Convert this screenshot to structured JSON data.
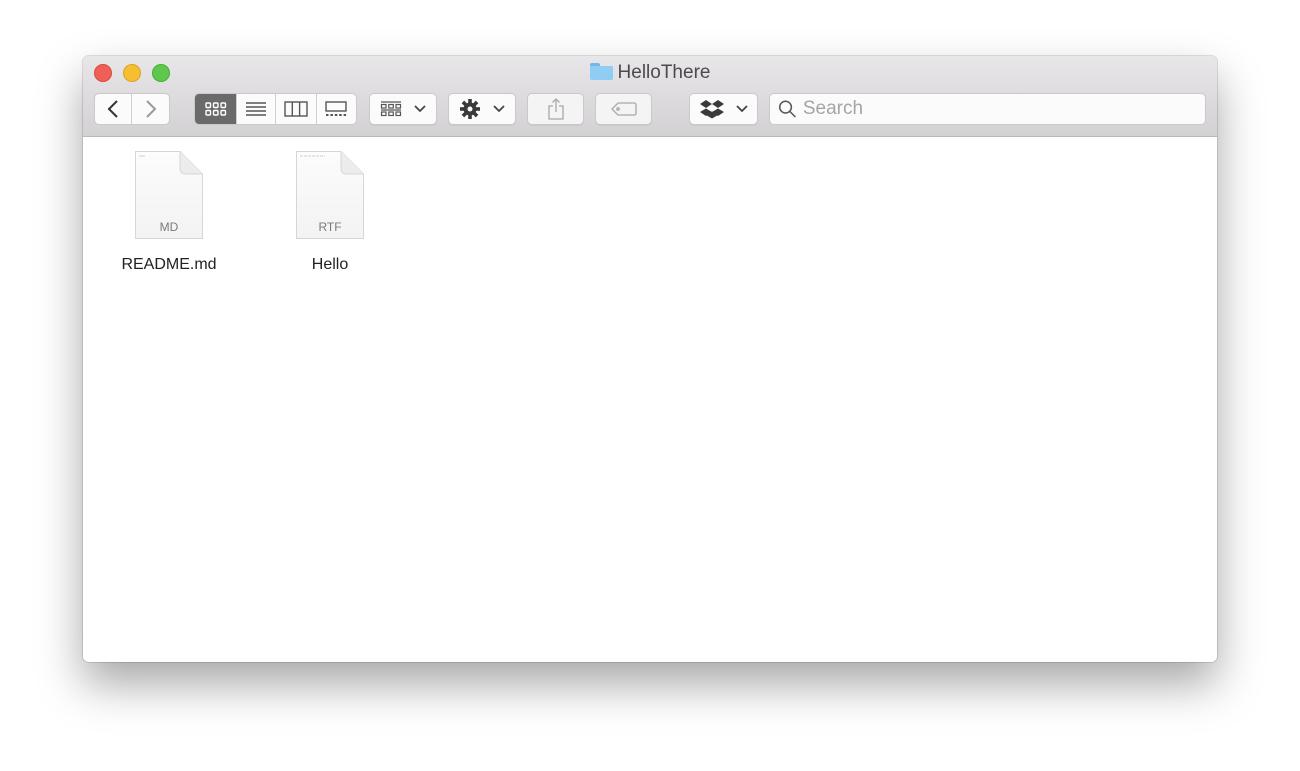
{
  "window": {
    "title": "HelloThere",
    "title_icon": "folder-icon"
  },
  "toolbar": {
    "back": {
      "icon": "chevron-left-icon",
      "label": "Back"
    },
    "forward": {
      "icon": "chevron-right-icon",
      "label": "Forward"
    },
    "view_modes": [
      {
        "name": "icon-view",
        "icon": "grid-icon",
        "active": true
      },
      {
        "name": "list-view",
        "icon": "list-icon",
        "active": false
      },
      {
        "name": "column-view",
        "icon": "columns-icon",
        "active": false
      },
      {
        "name": "gallery-view",
        "icon": "gallery-icon",
        "active": false
      }
    ],
    "group_menu": {
      "icon": "group-icon",
      "caret": "⌄"
    },
    "action_menu": {
      "icon": "gear-icon",
      "caret": "⌄"
    },
    "share": {
      "icon": "share-icon"
    },
    "tags": {
      "icon": "tag-icon"
    },
    "dropbox_menu": {
      "icon": "dropbox-icon",
      "caret": "⌄"
    },
    "search": {
      "placeholder": "Search",
      "value": ""
    }
  },
  "files": [
    {
      "name": "README.md",
      "type_label": "MD"
    },
    {
      "name": "Hello",
      "type_label": "RTF"
    }
  ]
}
